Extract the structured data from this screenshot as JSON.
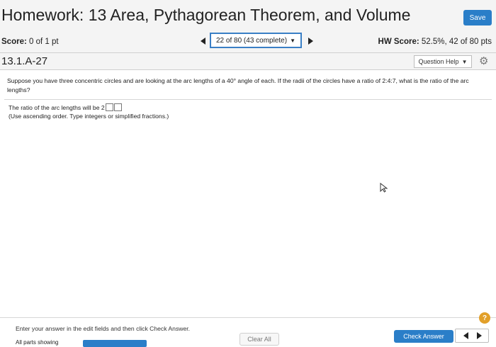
{
  "header": {
    "title": "Homework: 13 Area, Pythagorean Theorem, and Volume",
    "save_label": "Save"
  },
  "scorebar": {
    "score_label": "Score:",
    "score_value": "0 of 1 pt",
    "question_select": "22 of 80 (43 complete)",
    "hw_score_label": "HW Score:",
    "hw_score_value": "52.5%, 42 of 80 pts"
  },
  "question": {
    "id": "13.1.A-27",
    "help_label": "Question Help",
    "text": "Suppose you have three concentric circles and are looking at the arc lengths of a 40° angle of each. If the radii of the circles have a ratio of 2:4:7, what is the ratio of the arc lengths?",
    "answer_prefix": "The ratio of the arc lengths will be 2",
    "hint": "(Use ascending order. Type integers or simplified fractions.)"
  },
  "footer": {
    "instruction": "Enter your answer in the edit fields and then click Check Answer.",
    "all_parts": "All parts showing",
    "clear_all": "Clear All",
    "check_answer": "Check Answer",
    "help_icon": "?"
  },
  "colors": {
    "accent": "#2a7ec8",
    "help_badge": "#e2a02a"
  },
  "icons": [
    "gear-icon",
    "chevron-left-icon",
    "chevron-right-icon",
    "question-mark-icon",
    "mouse-cursor-icon"
  ]
}
